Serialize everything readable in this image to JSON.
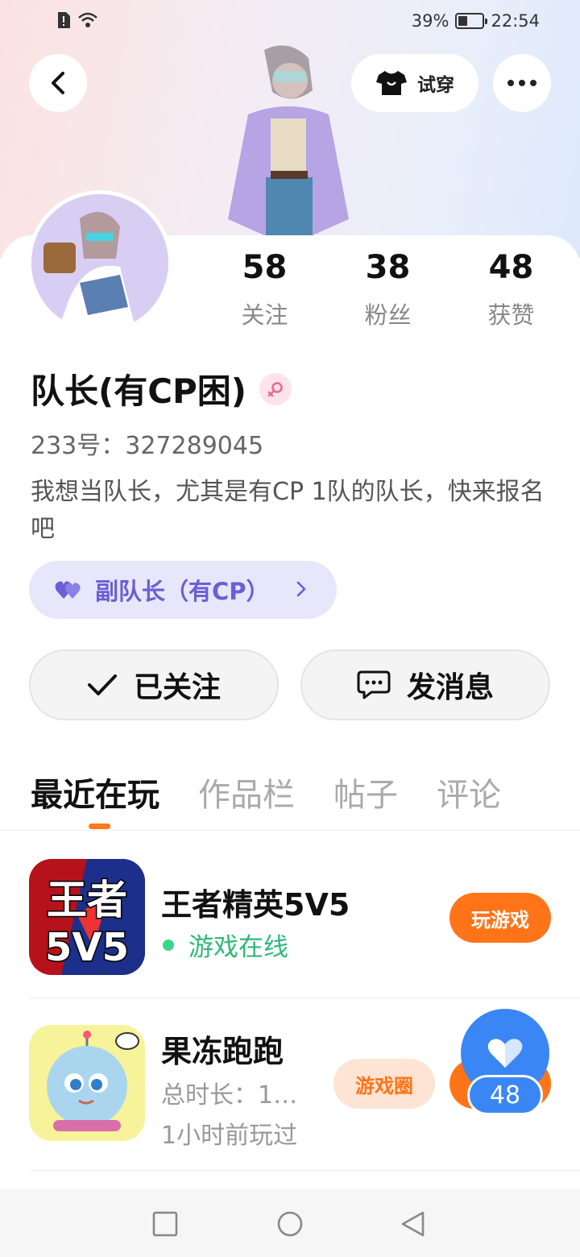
{
  "status_bar": {
    "battery": "39%",
    "time": "22:54"
  },
  "header": {
    "try_on_label": "试穿"
  },
  "stats": [
    {
      "value": "58",
      "label": "关注"
    },
    {
      "value": "38",
      "label": "粉丝"
    },
    {
      "value": "48",
      "label": "获赞"
    }
  ],
  "profile": {
    "name": "队长(有CP困)",
    "uid": "233号：327289045",
    "bio": "我想当队长，尤其是有CP 1队的队长，快来报名吧",
    "badge": "副队长（有CP）"
  },
  "actions": {
    "follow": "已关注",
    "message": "发消息"
  },
  "tabs": [
    {
      "label": "最近在玩",
      "active": true
    },
    {
      "label": "作品栏",
      "active": false
    },
    {
      "label": "帖子",
      "active": false
    },
    {
      "label": "评论",
      "active": false
    }
  ],
  "games": [
    {
      "title": "王者精英5V5",
      "status": "游戏在线",
      "button": "玩游戏",
      "icon_text_top": "王者",
      "icon_text_bottom": "5V5"
    },
    {
      "title": "果冻跑跑",
      "duration": "总时长：1…",
      "last_played": "1小时前玩过",
      "circle_button": "游戏圈"
    }
  ],
  "like_float": {
    "count": "48"
  },
  "colors": {
    "accent": "#ff7418",
    "online": "#2fb87a",
    "badge": "#6a5fd4",
    "like": "#3a86f5"
  }
}
